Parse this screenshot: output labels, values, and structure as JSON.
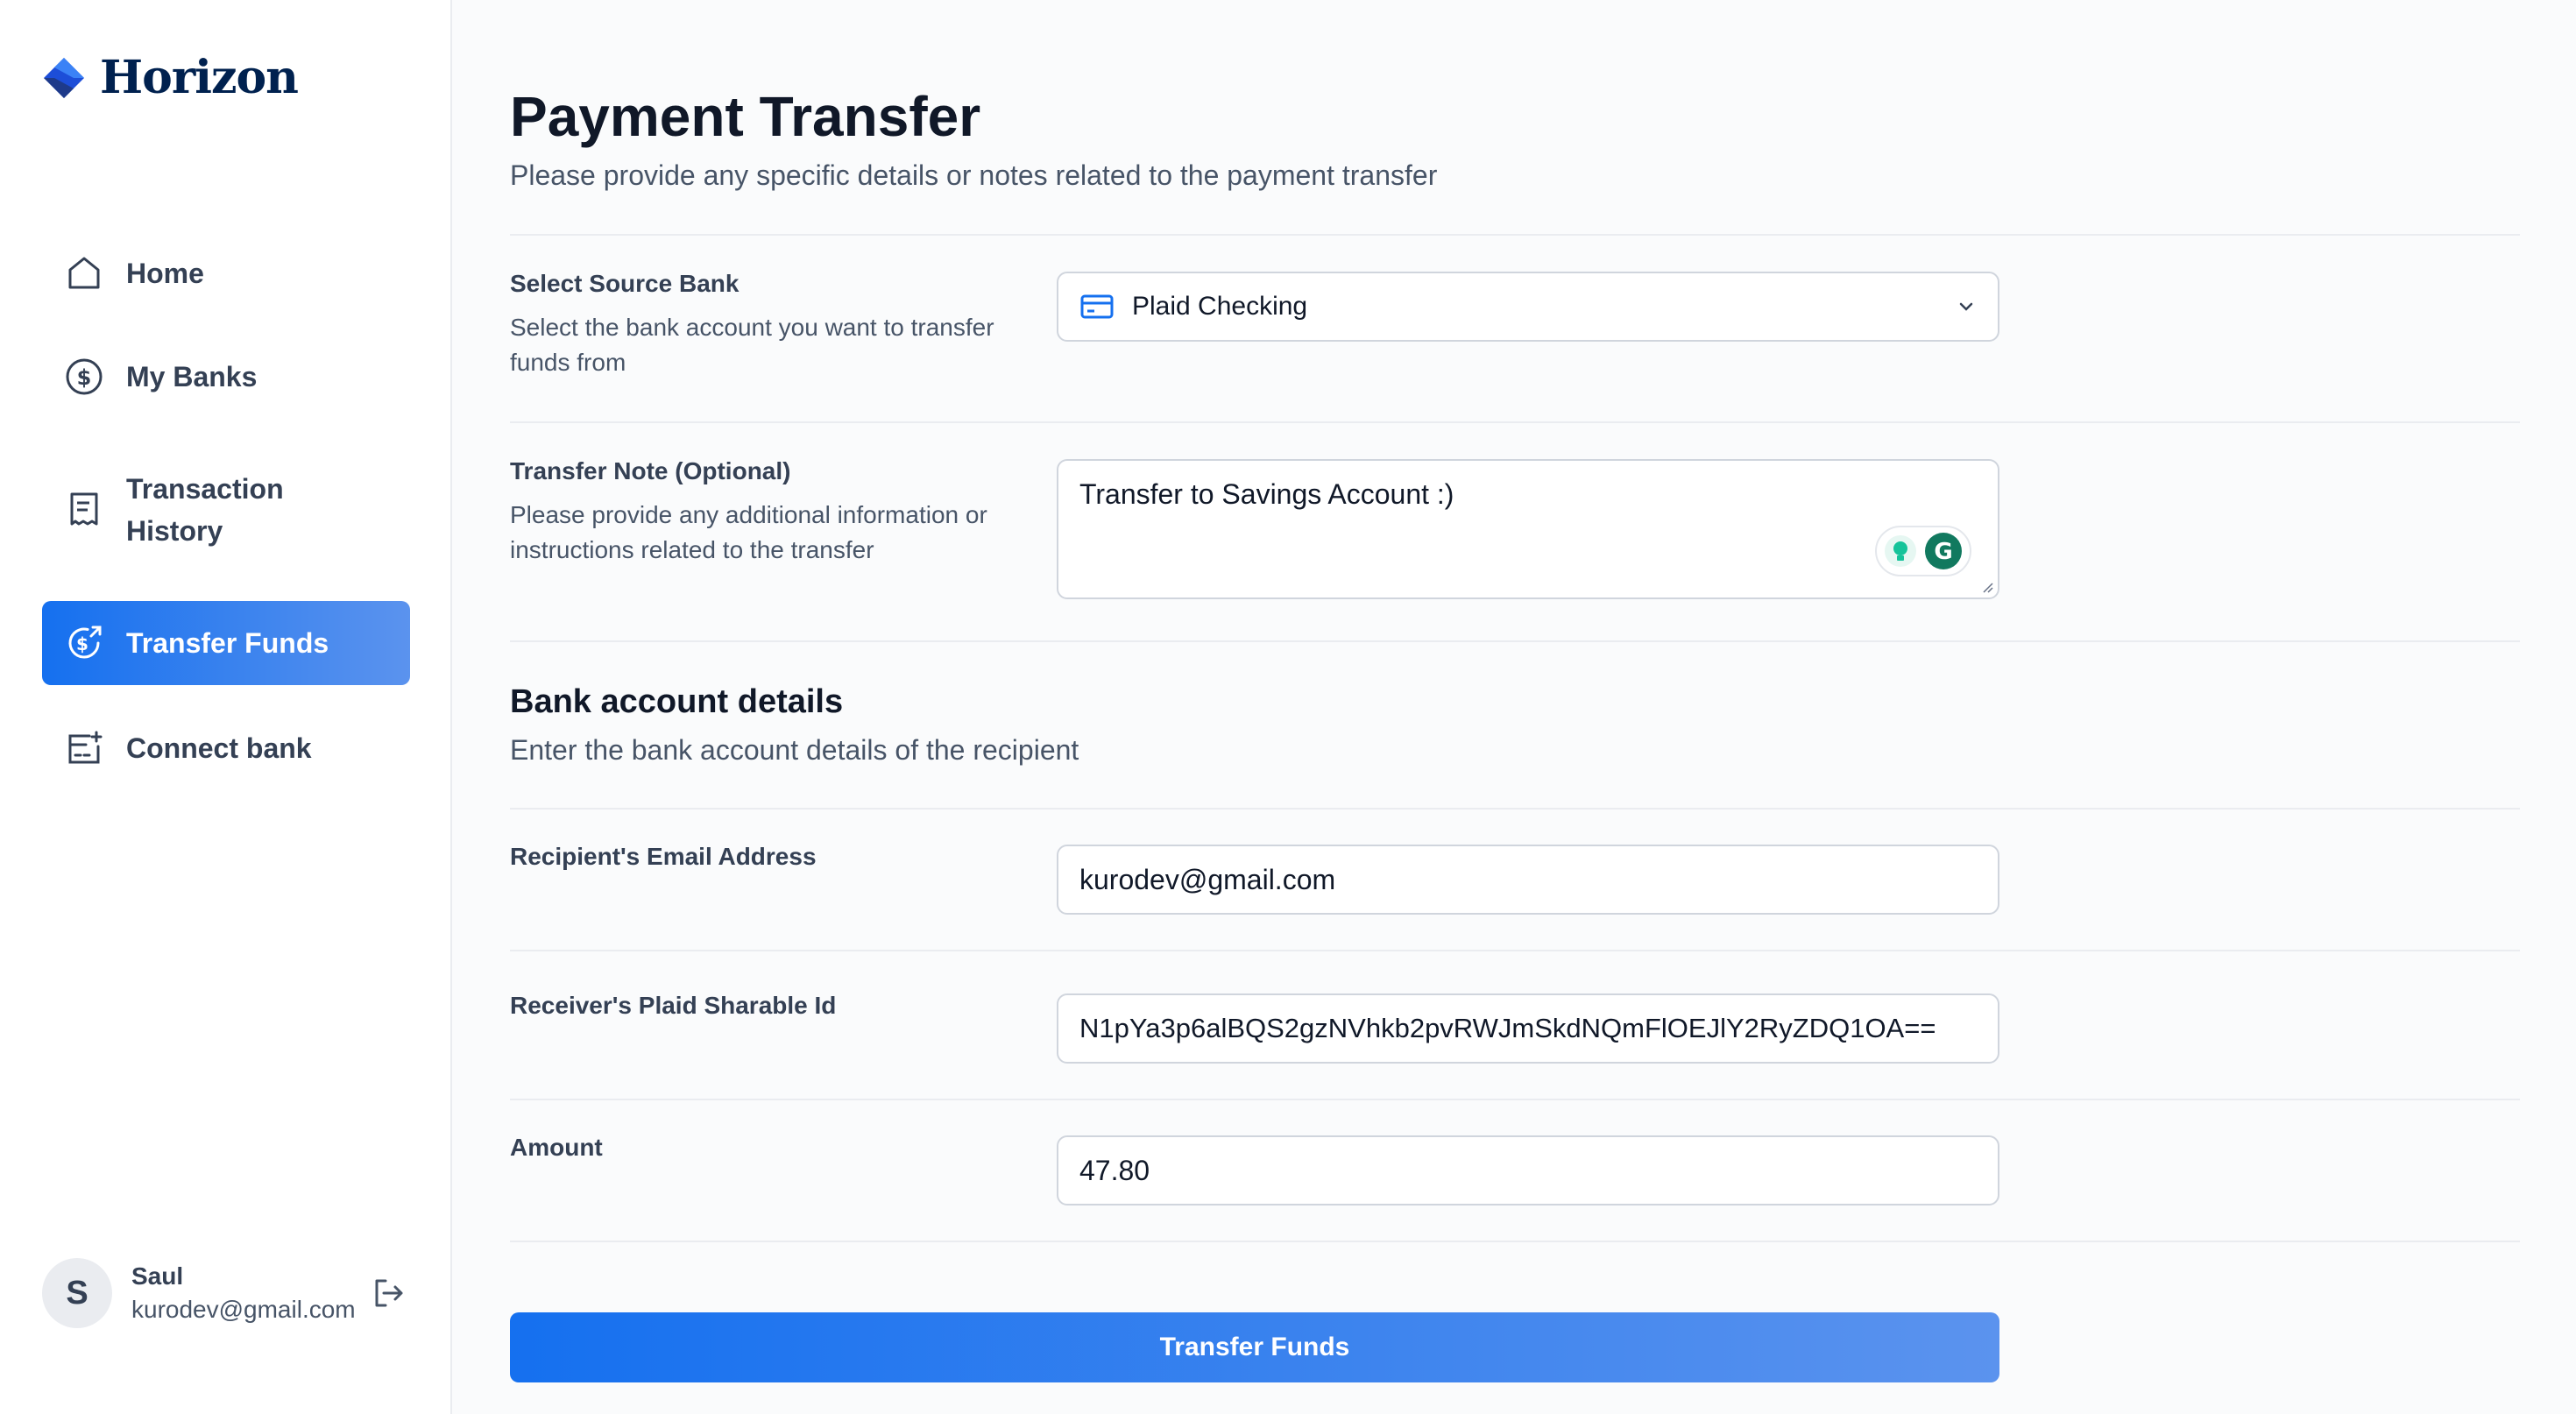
{
  "brand": {
    "name": "Horizon"
  },
  "sidebar": {
    "items": [
      {
        "label": "Home",
        "icon": "home-icon",
        "active": false
      },
      {
        "label": "My Banks",
        "icon": "dollar-circle-icon",
        "active": false
      },
      {
        "label": "Transaction History",
        "icon": "receipt-icon",
        "active": false
      },
      {
        "label": "Transfer Funds",
        "icon": "money-send-icon",
        "active": true
      },
      {
        "label": "Connect bank",
        "icon": "add-card-icon",
        "active": false
      }
    ]
  },
  "user": {
    "initial": "S",
    "name": "Saul",
    "email": "kurodev@gmail.com"
  },
  "page": {
    "title": "Payment Transfer",
    "subtitle": "Please provide any specific details or notes related to the payment transfer"
  },
  "form": {
    "source_bank": {
      "label": "Select Source Bank",
      "help": "Select the bank account you want to transfer funds from",
      "value": "Plaid Checking"
    },
    "note": {
      "label": "Transfer Note (Optional)",
      "help": "Please provide any additional information or instructions related to the transfer",
      "value": "Transfer to Savings Account :)"
    },
    "section": {
      "title": "Bank account details",
      "subtitle": "Enter the bank account details of the recipient"
    },
    "email": {
      "label": "Recipient's Email Address",
      "value": "kurodev@gmail.com"
    },
    "sharable_id": {
      "label": "Receiver's Plaid Sharable Id",
      "value": "N1pYa3p6alBQS2gzNVhkb2pvRWJmSkdNQmFlOEJlY2RyZDQ1OA=="
    },
    "amount": {
      "label": "Amount",
      "value": "47.80"
    },
    "submit_label": "Transfer Funds"
  },
  "colors": {
    "accent": "#1570ef",
    "accent_light": "#5b93ee",
    "brand_navy": "#00214f",
    "grammarly_green": "#15c39a"
  }
}
